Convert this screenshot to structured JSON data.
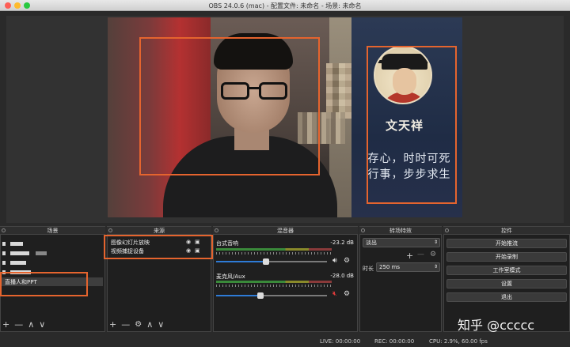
{
  "window": {
    "title": "OBS 24.0.6 (mac) - 配置文件: 未命名 - 场景: 未命名"
  },
  "preview": {
    "overlay_name": "文天祥",
    "overlay_quote_line1": "存心，时时可死",
    "overlay_quote_line2": "行事，步步求生"
  },
  "scenes": {
    "header": "场景",
    "selected_label": "直播人和PPT",
    "toolbar": {
      "add": "+",
      "remove": "—",
      "up": "∧",
      "down": "∨"
    }
  },
  "sources": {
    "header": "来源",
    "items": [
      {
        "label": "图像幻灯片放映"
      },
      {
        "label": "视频捕捉设备"
      }
    ],
    "toolbar": {
      "add": "+",
      "remove": "—",
      "settings": "⚙",
      "up": "∧",
      "down": "∨"
    }
  },
  "mixer": {
    "header": "混音器",
    "channels": [
      {
        "label": "台式音响",
        "db": "-23.2 dB",
        "level": 0.45,
        "muted": false
      },
      {
        "label": "麦克风/Aux",
        "db": "-28.0 dB",
        "level": 0.4,
        "muted": true
      }
    ]
  },
  "transitions": {
    "header": "转场特效",
    "selected": "淡出",
    "duration_label": "时长",
    "duration_value": "250 ms",
    "add": "+",
    "remove": "—"
  },
  "controls": {
    "header": "控件",
    "buttons": [
      {
        "label": "开始推流"
      },
      {
        "label": "开始录制"
      },
      {
        "label": "工作室模式"
      },
      {
        "label": "设置"
      },
      {
        "label": "退出"
      }
    ]
  },
  "status": {
    "live": "LIVE: 00:00:00",
    "rec": "REC: 00:00:00",
    "cpu": "CPU: 2.9%, 60.00 fps"
  },
  "watermark": "知乎 @ccccc",
  "colors": {
    "highlight": "#e5642e",
    "slider": "#2e7bd6"
  }
}
